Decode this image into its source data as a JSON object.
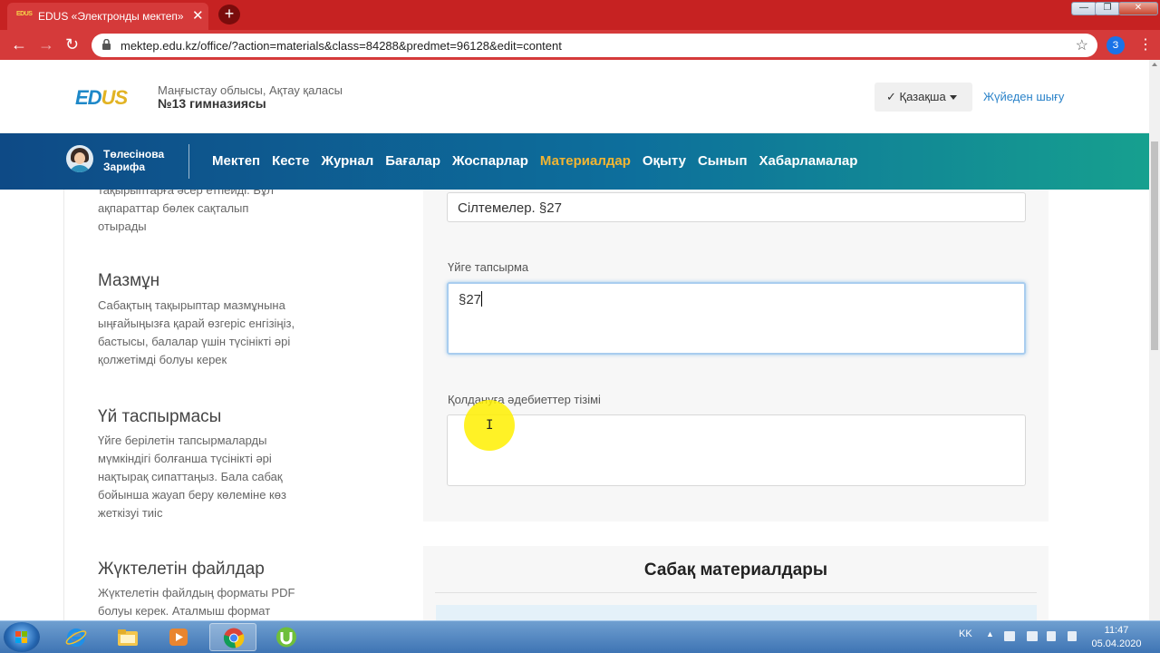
{
  "browser": {
    "tab_title": "EDUS «Электронды мектеп» - N",
    "tab_favicon": "EDUS",
    "tab_close": "✕",
    "new_tab": "+",
    "url": "mektep.edu.kz/office/?action=materials&class=84288&predmet=96128&edit=content",
    "profile_initial": "З",
    "window_controls": [
      "—",
      "❐",
      "✕"
    ],
    "nav": [
      "←",
      "→",
      "↻"
    ],
    "star": "☆",
    "menu": "⋮",
    "accent_color": "#d53a3a"
  },
  "header": {
    "logo_part1": "ED",
    "logo_part2": "US",
    "region": "Маңғыстау облысы, Ақтау қаласы",
    "school": "№13 гимназиясы",
    "language": "✓ Қазақша",
    "logout": "Жүйеден шығу"
  },
  "navbar": {
    "user_line1": "Төлесінова",
    "user_line2": "Зарифа",
    "items": [
      "Мектеп",
      "Кесте",
      "Журнал",
      "Бағалар",
      "Жоспарлар",
      "Материалдар",
      "Оқыту",
      "Сынып",
      "Хабарламалар"
    ],
    "active_item": "Материалдар",
    "active_color": "#f2b532"
  },
  "help": {
    "top_text_1": "тақырыптарға әсер етпейді. Бұл",
    "top_text_2": "ақпараттар бөлек сақталып",
    "top_text_3": "отырады",
    "content_title": "Мазмұн",
    "content_text": [
      "Сабақтың тақырыптар мазмұнына",
      "ыңғайыңызға қарай өзгеріс енгізіңіз,",
      "бастысы, балалар үшін түсінікті әрі",
      "қолжетімді болуы керек"
    ],
    "homework_title": "Үй таспырмасы",
    "homework_text": [
      "Үйге берілетін тапсырмаларды",
      "мүмкіндігі болғанша түсінікті әрі",
      "нақтырақ сипаттаңыз. Бала сабақ",
      "бойынша жауап беру көлеміне көз",
      "жеткізуі тиіс"
    ],
    "files_title": "Жүктелетін файлдар",
    "files_text": [
      "Жүктелетін файлдың форматы PDF",
      "болуы керек. Аталмыш формат"
    ]
  },
  "form": {
    "references_value": "Сілтемелер. §27",
    "homework_label": "Үйге тапсырма",
    "homework_value": "§27",
    "literature_label": "Қолдануға әдебиеттер тізімі",
    "literature_value": ""
  },
  "materials": {
    "title": "Сабақ материалдары"
  },
  "taskbar": {
    "language": "KK",
    "time": "11:47",
    "date": "05.04.2020"
  }
}
